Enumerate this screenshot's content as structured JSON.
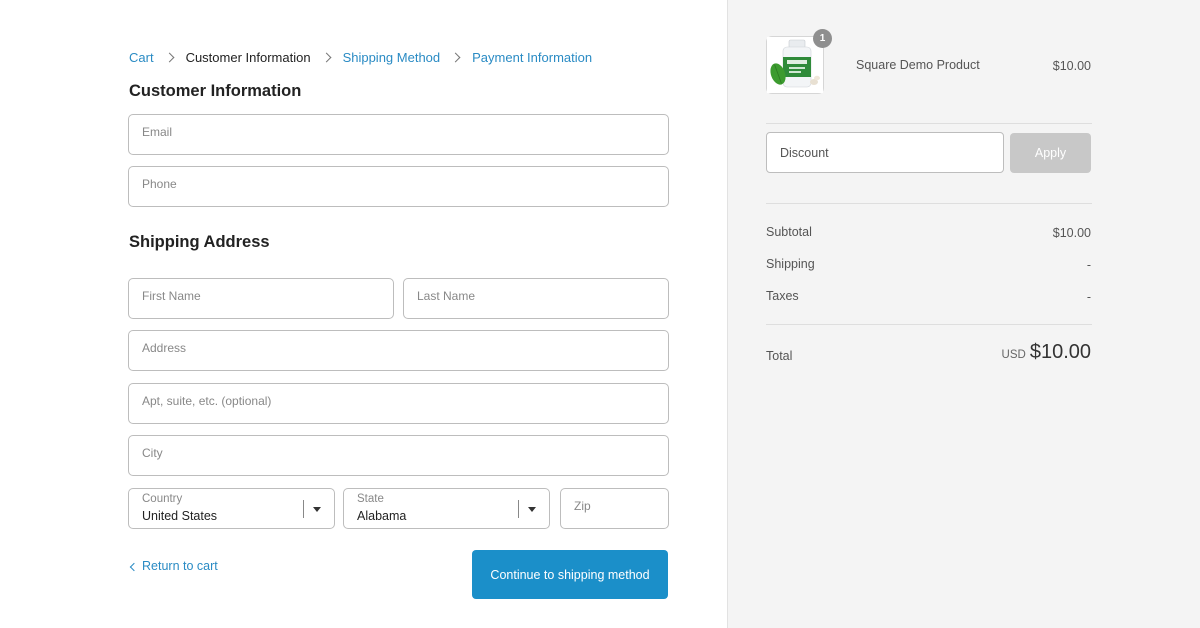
{
  "breadcrumb": {
    "items": [
      "Cart",
      "Customer Information",
      "Shipping Method",
      "Payment Information"
    ]
  },
  "customer": {
    "title": "Customer Information",
    "email_placeholder": "Email",
    "phone_placeholder": "Phone"
  },
  "shipping": {
    "title": "Shipping Address",
    "first_name_placeholder": "First Name",
    "last_name_placeholder": "Last Name",
    "address_placeholder": "Address",
    "apt_placeholder": "Apt, suite, etc. (optional)",
    "city_placeholder": "City",
    "country_label": "Country",
    "country_value": "United States",
    "state_label": "State",
    "state_value": "Alabama",
    "zip_placeholder": "Zip"
  },
  "actions": {
    "return_label": "Return to cart",
    "continue_label": "Continue to shipping method"
  },
  "order": {
    "product_name": "Square Demo Product",
    "product_price": "$10.00",
    "quantity": "1",
    "discount_placeholder": "Discount",
    "apply_label": "Apply",
    "subtotal_label": "Subtotal",
    "subtotal_value": "$10.00",
    "shipping_label": "Shipping",
    "shipping_value": "-",
    "taxes_label": "Taxes",
    "taxes_value": "-",
    "total_label": "Total",
    "total_currency": "USD",
    "total_value": "$10.00"
  },
  "colors": {
    "accent": "#1b8fc9",
    "link": "#2a8bc4",
    "apply_disabled": "#c8c8c8",
    "sidebar_bg": "#f4f4f4"
  }
}
